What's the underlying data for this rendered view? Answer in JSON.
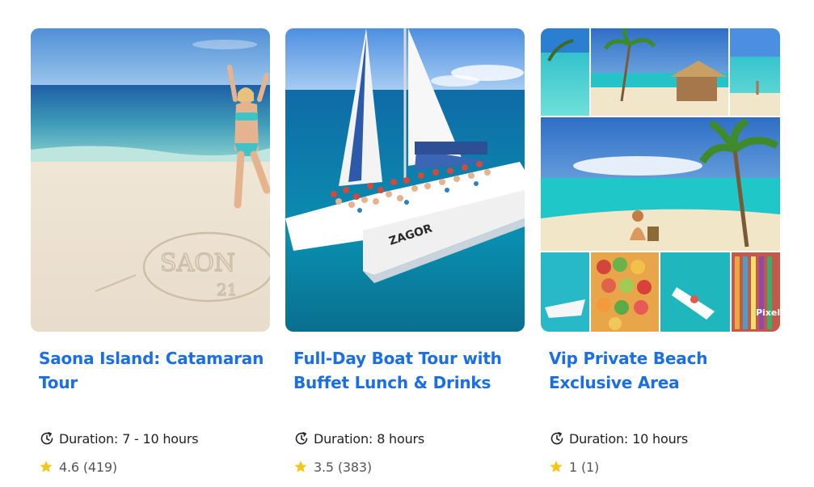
{
  "cards": [
    {
      "title": "Saona Island: Catamaran Tour",
      "duration_label": "Duration:",
      "duration_value": "7 - 10 hours",
      "rating": "4.6",
      "review_count": "(419)",
      "image_alt": "Woman in swimsuit on sandy beach with heart drawn in sand"
    },
    {
      "title": "Full-Day Boat Tour with Buffet Lunch & Drinks",
      "duration_label": "Duration:",
      "duration_value": "8 hours",
      "rating": "3.5",
      "review_count": "(383)",
      "image_alt": "White catamaran full of passengers on turquoise sea",
      "boat_name": "ZAGOR"
    },
    {
      "title": "Vip Private Beach Exclusive Area",
      "duration_label": "Duration:",
      "duration_value": "10 hours",
      "rating": "1",
      "review_count": "(1)",
      "image_alt": "Collage of tropical beach, palm trees, fruit and boats",
      "watermark": "Pixel"
    }
  ],
  "colors": {
    "title": "#1a6ee6",
    "star": "#f5c518",
    "text": "#222222",
    "muted": "#555555"
  },
  "icons": {
    "duration": "clock-refresh-icon",
    "rating": "star-icon"
  }
}
